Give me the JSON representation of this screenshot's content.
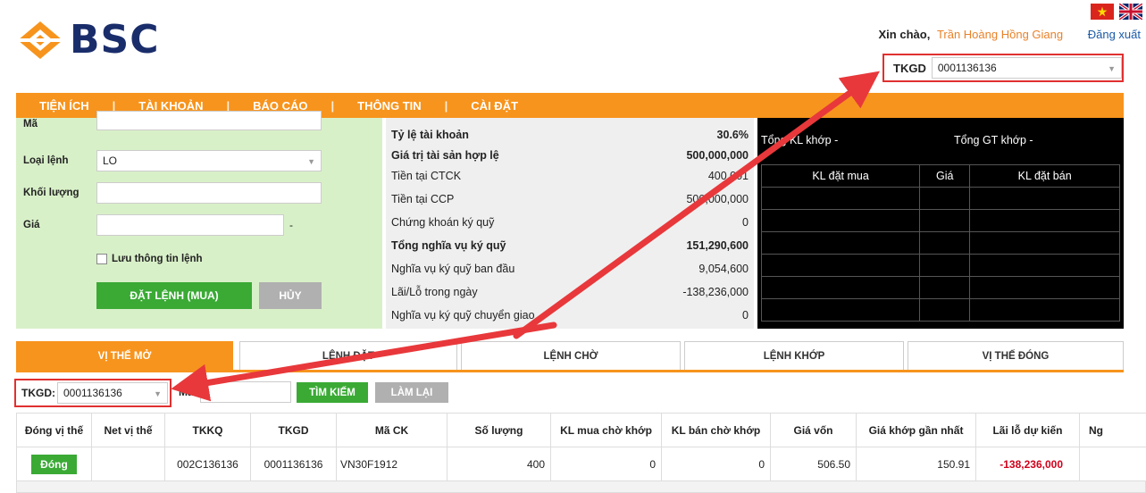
{
  "header": {
    "logo_text": "BSC",
    "greeting": "Xin chào,",
    "username": "Trần Hoàng Hồng Giang",
    "logout": "Đăng xuất",
    "tkgd_label": "TKGD",
    "tkgd_value": "0001136136"
  },
  "nav": [
    "TIỆN ÍCH",
    "TÀI KHOẢN",
    "BÁO CÁO",
    "THÔNG TIN",
    "CÀI ĐẶT"
  ],
  "order_form": {
    "ma_label": "Mã",
    "order_type_label": "Loại lệnh",
    "order_type_value": "LO",
    "volume_label": "Khối lượng",
    "price_label": "Giá",
    "price_suffix": "-",
    "save_checkbox_label": "Lưu thông tin lệnh",
    "submit_label": "ĐẶT LỆNH (MUA)",
    "cancel_label": "HỦY"
  },
  "account": [
    {
      "label": "Tỷ lệ tài khoản",
      "value": "30.6%",
      "bold": true
    },
    {
      "label": "Giá trị tài sản hợp lệ",
      "value": "500,000,000",
      "bold": true
    },
    {
      "label": "Tiền tại CTCK",
      "value": "400,001",
      "bold": false
    },
    {
      "label": "Tiền tại CCP",
      "value": "500,000,000",
      "bold": false
    },
    {
      "label": "Chứng khoán ký quỹ",
      "value": "0",
      "bold": false
    },
    {
      "label": "Tổng nghĩa vụ ký quỹ",
      "value": "151,290,600",
      "bold": true
    },
    {
      "label": "Nghĩa vụ ký quỹ ban đầu",
      "value": "9,054,600",
      "bold": false
    },
    {
      "label": "Lãi/Lỗ trong ngày",
      "value": "-138,236,000",
      "bold": false
    },
    {
      "label": "Nghĩa vụ ký quỹ chuyển giao",
      "value": "0",
      "bold": false
    }
  ],
  "depth": {
    "total_volume": "Tổng KL khớp -",
    "total_value": "Tổng GT khớp -",
    "headers": [
      "KL đặt mua",
      "Giá",
      "KL đặt bán"
    ]
  },
  "tabs": [
    "VỊ THẾ MỞ",
    "LỆNH ĐẶT",
    "LỆNH CHỜ",
    "LỆNH KHỚP",
    "VỊ THẾ ĐÓNG"
  ],
  "filter": {
    "tkgd_label": "TKGD:",
    "tkgd_value": "0001136136",
    "ma_label": "Mã:",
    "search_label": "TÌM KIẾM",
    "reset_label": "LÀM LẠI"
  },
  "table": {
    "headers": [
      "Đóng vị thế",
      "Net vị thế",
      "TKKQ",
      "TKGD",
      "Mã CK",
      "Số lượng",
      "KL mua chờ khớp",
      "KL bán chờ khớp",
      "Giá vốn",
      "Giá khớp gần nhất",
      "Lãi lỗ dự kiến",
      "Ng"
    ],
    "row": {
      "close_label": "Đóng",
      "net": "",
      "tkkq": "002C136136",
      "tkgd": "0001136136",
      "ma_ck": "VN30F1912",
      "qty": "400",
      "buy_wait": "0",
      "sell_wait": "0",
      "cost": "506.50",
      "last_price": "150.91",
      "pnl": "-138,236,000"
    }
  },
  "colors": {
    "accent": "#f7941d",
    "brand": "#1a2d6b",
    "green": "#3aaa35",
    "loss": "#d0021b",
    "highlight": "#e03030"
  }
}
